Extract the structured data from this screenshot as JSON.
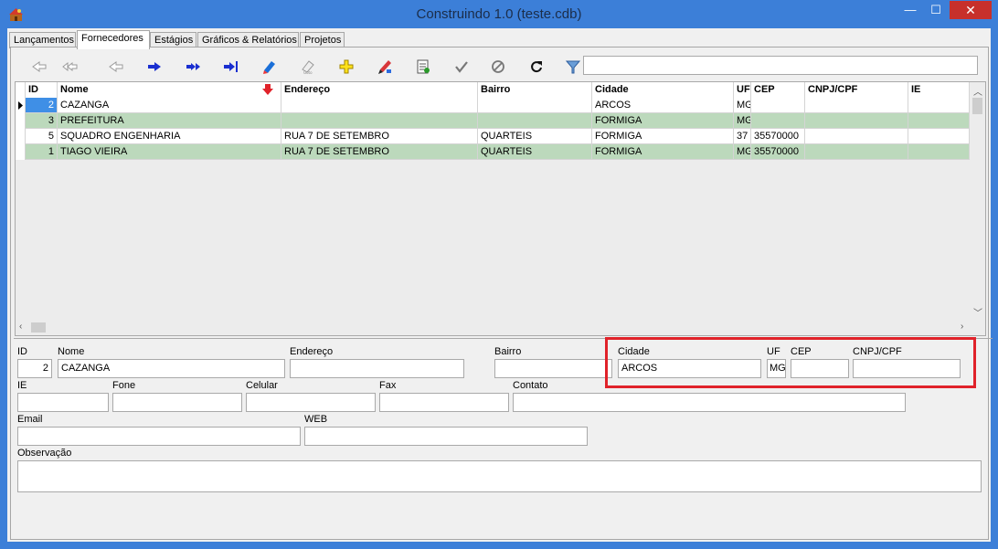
{
  "window": {
    "title": "Construindo 1.0 (teste.cdb)",
    "minimize_label": "—",
    "maximize_label": "☐",
    "close_label": "✕"
  },
  "tabs": [
    {
      "label": "Lançamentos",
      "active": false
    },
    {
      "label": "Fornecedores",
      "active": true
    },
    {
      "label": "Estágios",
      "active": false
    },
    {
      "label": "Gráficos & Relatórios",
      "active": false
    },
    {
      "label": "Projetos",
      "active": false
    }
  ],
  "toolbar": {
    "icons": [
      "first-icon",
      "prior-page-icon",
      "prior-icon",
      "next-icon",
      "next-page-icon",
      "last-icon",
      "insert-icon",
      "delete-icon",
      "add-icon",
      "edit-icon",
      "refresh-record-icon",
      "post-icon",
      "cancel-icon",
      "refresh-icon",
      "filter-icon"
    ],
    "search_value": ""
  },
  "grid": {
    "columns": [
      "ID",
      "Nome",
      "Endereço",
      "Bairro",
      "Cidade",
      "UF",
      "CEP",
      "CNPJ/CPF",
      "IE"
    ],
    "sort_indicator": "Nome",
    "rows": [
      {
        "id": "2",
        "nome": "CAZANGA",
        "endereco": "",
        "bairro": "",
        "cidade": "ARCOS",
        "uf": "MG",
        "cep": "",
        "cnpj": "",
        "ie": "",
        "style": "white",
        "current": true
      },
      {
        "id": "3",
        "nome": "PREFEITURA",
        "endereco": "",
        "bairro": "",
        "cidade": "FORMIGA",
        "uf": "MG",
        "cep": "",
        "cnpj": "",
        "ie": "",
        "style": "green",
        "current": false
      },
      {
        "id": "5",
        "nome": "SQUADRO ENGENHARIA",
        "endereco": "RUA 7 DE SETEMBRO",
        "bairro": "QUARTEIS",
        "cidade": "FORMIGA",
        "uf": "37",
        "cep": "35570000",
        "cnpj": "",
        "ie": "",
        "style": "white",
        "current": false
      },
      {
        "id": "1",
        "nome": "TIAGO VIEIRA",
        "endereco": "RUA 7 DE SETEMBRO",
        "bairro": "QUARTEIS",
        "cidade": "FORMIGA",
        "uf": "MG",
        "cep": "35570000",
        "cnpj": "",
        "ie": "",
        "style": "green",
        "current": false
      }
    ]
  },
  "form": {
    "id": {
      "label": "ID",
      "value": "2"
    },
    "nome": {
      "label": "Nome",
      "value": "CAZANGA"
    },
    "endereco": {
      "label": "Endereço",
      "value": ""
    },
    "bairro": {
      "label": "Bairro",
      "value": ""
    },
    "cidade": {
      "label": "Cidade",
      "value": "ARCOS"
    },
    "uf": {
      "label": "UF",
      "value": "MG"
    },
    "cep": {
      "label": "CEP",
      "value": ""
    },
    "cnpj": {
      "label": "CNPJ/CPF",
      "value": ""
    },
    "ie": {
      "label": "IE",
      "value": ""
    },
    "fone": {
      "label": "Fone",
      "value": ""
    },
    "celular": {
      "label": "Celular",
      "value": ""
    },
    "fax": {
      "label": "Fax",
      "value": ""
    },
    "contato": {
      "label": "Contato",
      "value": ""
    },
    "email": {
      "label": "Email",
      "value": ""
    },
    "web": {
      "label": "WEB",
      "value": ""
    },
    "observacao": {
      "label": "Observação",
      "value": ""
    }
  },
  "colors": {
    "titlebar": "#3c7fd8",
    "row_green": "#bcd9bc",
    "selection": "#3f8fe6",
    "highlight": "#e0222a"
  }
}
